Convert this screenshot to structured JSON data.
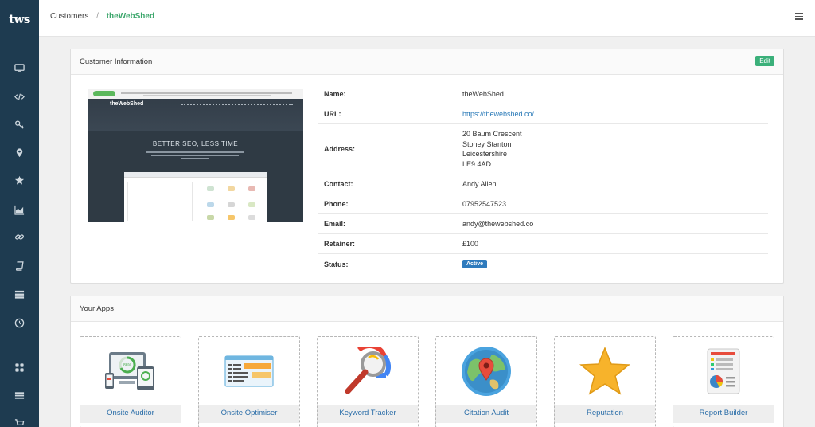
{
  "logo": {
    "text": "tws"
  },
  "sidebar": {
    "icons": [
      "monitor-icon",
      "code-icon",
      "key-icon",
      "map-pin-icon",
      "star-icon",
      "area-chart-icon",
      "link-icon",
      "book-icon",
      "server-icon",
      "clock-icon",
      "grid-icon",
      "list-icon",
      "cart-icon"
    ]
  },
  "breadcrumb": {
    "parent": "Customers",
    "separator": "/",
    "current": "theWebShed"
  },
  "customer_panel": {
    "title": "Customer Information",
    "edit_label": "Edit",
    "thumbnail": {
      "brand": "theWebShed",
      "headline": "BETTER SEO, LESS TIME"
    },
    "rows": [
      {
        "label": "Name:",
        "value": [
          "theWebShed"
        ]
      },
      {
        "label": "URL:",
        "value": [
          "https://thewebshed.co/"
        ]
      },
      {
        "label": "Address:",
        "value": [
          "20 Baum Crescent",
          "Stoney Stanton",
          "Leicestershire",
          "LE9 4AD"
        ]
      },
      {
        "label": "Contact:",
        "value": [
          "Andy Allen"
        ]
      },
      {
        "label": "Phone:",
        "value": [
          "07952547523"
        ]
      },
      {
        "label": "Email:",
        "value": [
          "andy@thewebshed.co"
        ]
      },
      {
        "label": "Retainer:",
        "value": [
          "£100"
        ]
      },
      {
        "label": "Status:",
        "value": [
          "Active"
        ]
      }
    ]
  },
  "apps_panel": {
    "title": "Your Apps",
    "apps": [
      {
        "label": "Onsite Auditor",
        "icon": "devices-icon",
        "gauge": "86%"
      },
      {
        "label": "Onsite Optimiser",
        "icon": "webpage-layout-icon"
      },
      {
        "label": "Keyword Tracker",
        "icon": "magnifier-icon"
      },
      {
        "label": "Citation Audit",
        "icon": "globe-pin-icon"
      },
      {
        "label": "Reputation",
        "icon": "star-icon"
      },
      {
        "label": "Report Builder",
        "icon": "report-document-icon"
      }
    ]
  },
  "colors": {
    "sidebar": "#1e3b50",
    "accent_green": "#3bb07a",
    "link_blue": "#2a7ab8",
    "badge_blue": "#2f7bbd"
  }
}
